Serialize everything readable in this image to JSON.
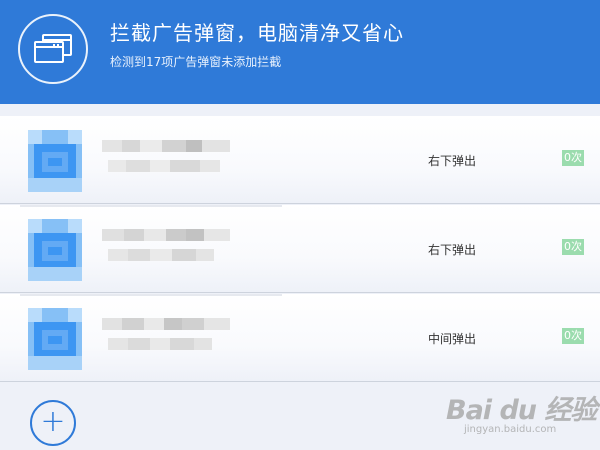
{
  "header": {
    "title": "拦截广告弹窗，电脑清净又省心",
    "subtitle": "检测到17项广告弹窗未添加拦截",
    "icon": "windows-icon",
    "bg_color": "#2f7ad8"
  },
  "popups": [
    {
      "position": "右下弹出",
      "count": "0次"
    },
    {
      "position": "右下弹出",
      "count": "0次"
    },
    {
      "position": "中间弹出",
      "count": "0次"
    }
  ],
  "add_button": {
    "label": "+"
  },
  "watermark": {
    "logo": "Bai du 经验",
    "url": "jingyan.baidu.com"
  }
}
